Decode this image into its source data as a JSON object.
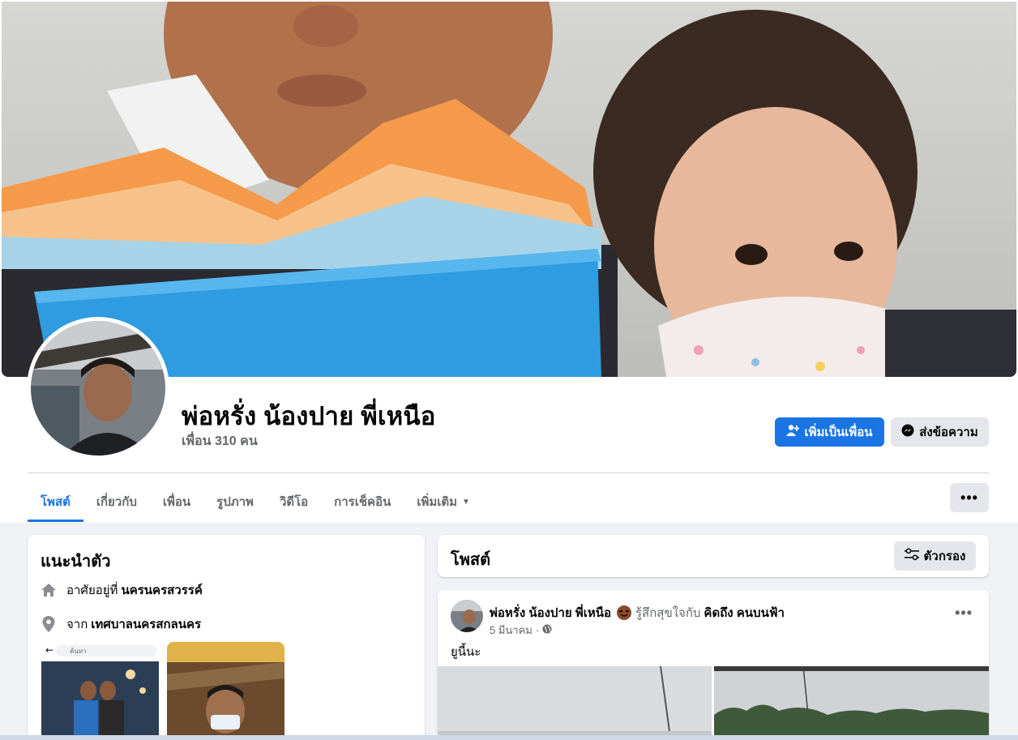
{
  "profile": {
    "name": "พ่อหรั่ง น้องปาย พี่เหนือ",
    "friends": "เพื่อน 310 คน"
  },
  "actions": {
    "add_friend": "เพิ่มเป็นเพื่อน",
    "message": "ส่งข้อความ"
  },
  "tabs": [
    {
      "label": "โพสต์",
      "active": true
    },
    {
      "label": "เกี่ยวกับ"
    },
    {
      "label": "เพื่อน"
    },
    {
      "label": "รูปภาพ"
    },
    {
      "label": "วิดีโอ"
    },
    {
      "label": "การเช็คอิน"
    },
    {
      "label": "เพิ่มเติม"
    }
  ],
  "more_options": "•••",
  "intro": {
    "title": "แนะนำตัว",
    "lives_prefix": "อาศัยอยู่ที่",
    "lives_place": "นครนครสวรรค์",
    "from_prefix": "จาก",
    "from_place": "เทศบาลนครสกลนคร",
    "thumb_search": "ค้นหา"
  },
  "posts": {
    "title": "โพสต์",
    "filter": "ตัวกรอง"
  },
  "post": {
    "author": "พ่อหรั่ง น้องปาย พี่เหนือ",
    "feeling": "รู้สึกสุขใจกับ",
    "tagged": "คิดถึง คนบนฟ้า",
    "date": "5 มีนาคม",
    "separator": "·",
    "text": "ยูนี้นะ",
    "options": "•••"
  },
  "colors": {
    "primary": "#1b74e4",
    "secondary_bg": "#e4e6eb",
    "page_bg": "#f0f2f5",
    "muted_text": "#65676b"
  }
}
